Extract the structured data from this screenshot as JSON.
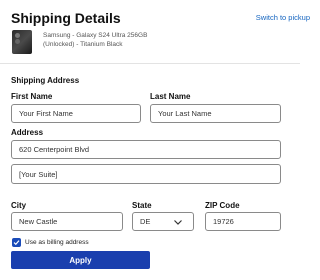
{
  "header": {
    "title": "Shipping Details",
    "switch_link": "Switch to pickup"
  },
  "product": {
    "line1": "Samsung - Galaxy S24 Ultra 256GB",
    "line2": "(Unlocked) - Titanium Black"
  },
  "form": {
    "section_title": "Shipping Address",
    "first_name": {
      "label": "First Name",
      "placeholder": "Your First Name"
    },
    "last_name": {
      "label": "Last Name",
      "placeholder": "Your Last Name"
    },
    "address": {
      "label": "Address",
      "value": "620 Centerpoint Blvd"
    },
    "suite": {
      "placeholder": "[Your Suite]"
    },
    "city": {
      "label": "City",
      "value": "New Castle"
    },
    "state": {
      "label": "State",
      "value": "DE"
    },
    "zip": {
      "label": "ZIP Code",
      "value": "19726"
    },
    "billing": {
      "label": "Use as billing address",
      "checked": true
    },
    "apply_label": "Apply"
  },
  "colors": {
    "accent": "#1a3fae",
    "link": "#1565c0"
  }
}
